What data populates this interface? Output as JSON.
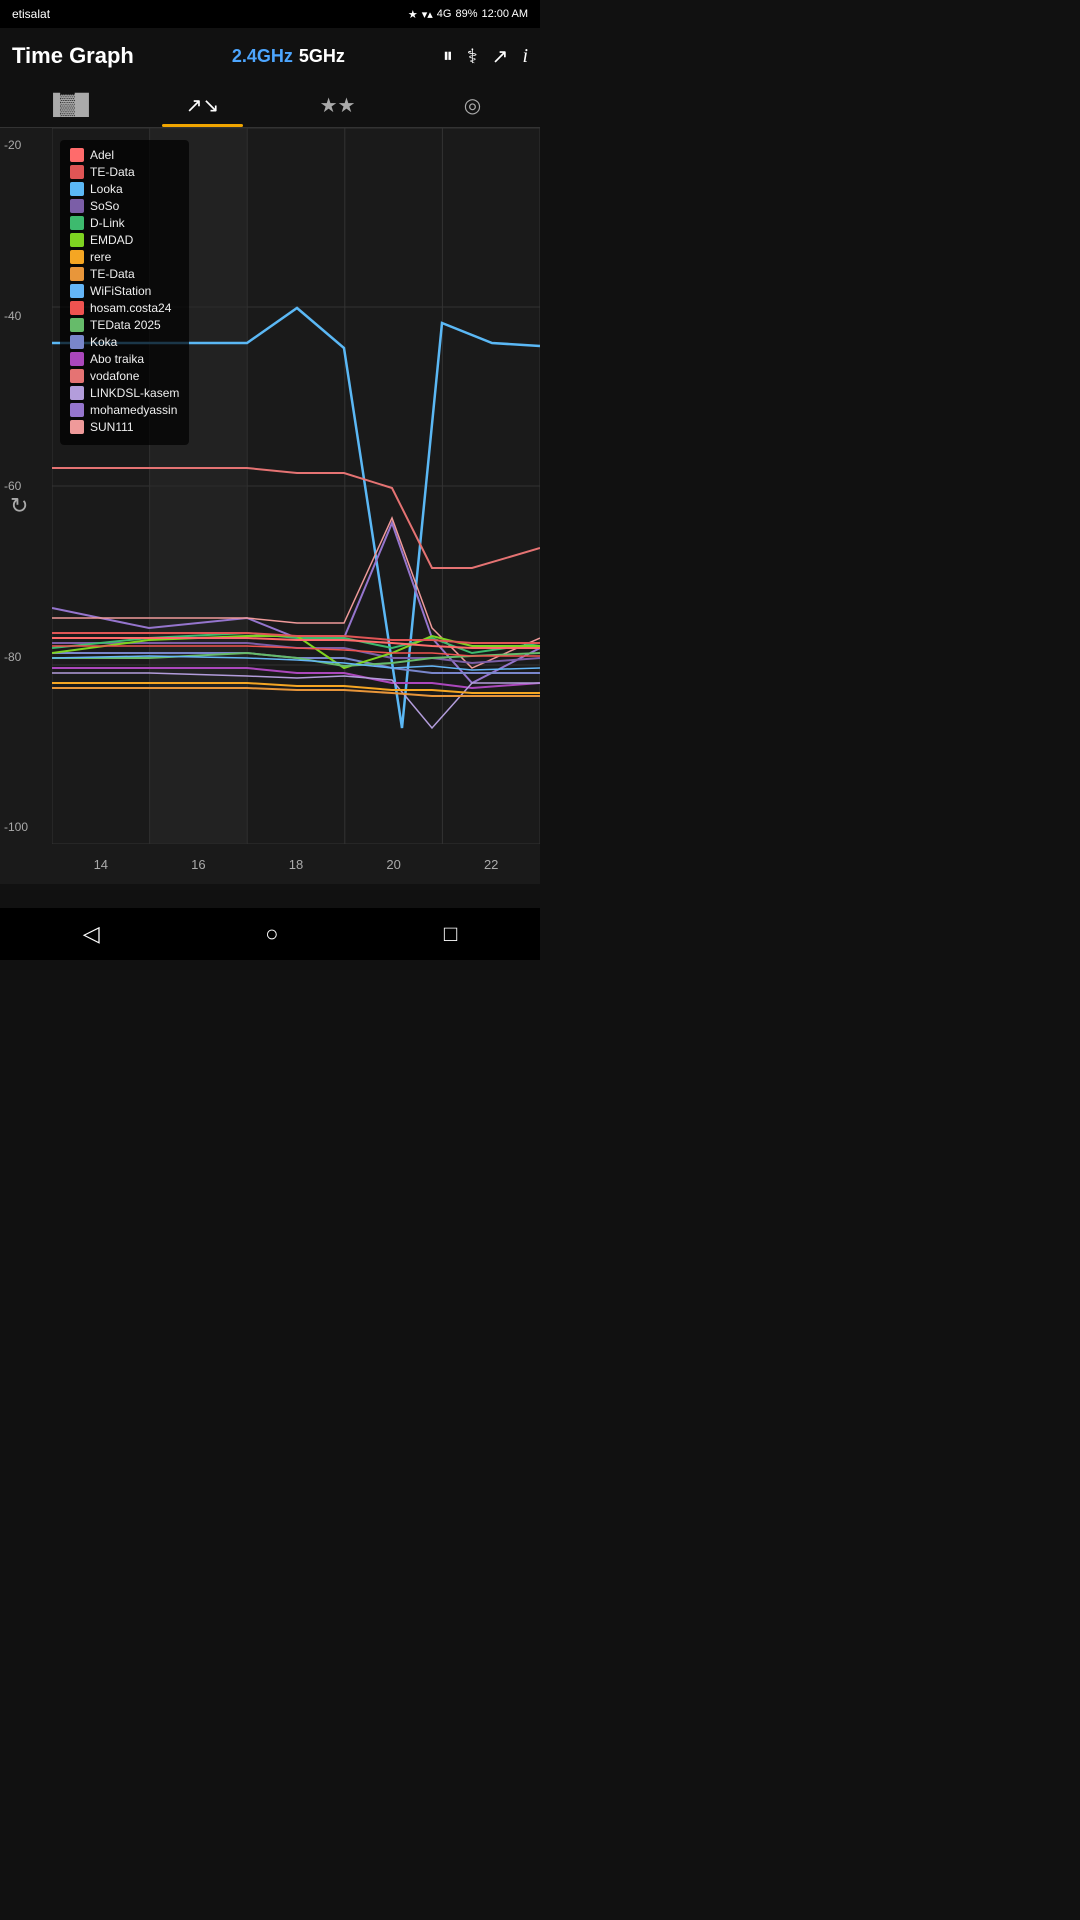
{
  "statusBar": {
    "carrier": "etisalat",
    "icons": "bluetooth wifi 4g signal",
    "battery": "89%",
    "time": "12:00 AM"
  },
  "header": {
    "title": "Time Graph",
    "freq24": "2.4GHz",
    "freq5": "5GHz",
    "icons": [
      "pause",
      "stethoscope",
      "share",
      "info"
    ]
  },
  "tabs": [
    {
      "label": "bar-chart",
      "active": false
    },
    {
      "label": "time-graph",
      "active": true
    },
    {
      "label": "rating",
      "active": false
    },
    {
      "label": "radar",
      "active": false
    }
  ],
  "chart": {
    "yLabels": [
      "-20",
      "-40",
      "-60",
      "-80",
      "-100"
    ],
    "xLabels": [
      "14",
      "16",
      "18",
      "20",
      "22"
    ],
    "legend": [
      {
        "name": "Adel",
        "color": "#ff6b6b"
      },
      {
        "name": "TE-Data",
        "color": "#e05555"
      },
      {
        "name": "Looka",
        "color": "#5bb8f5"
      },
      {
        "name": "SoSo",
        "color": "#7b5ea7"
      },
      {
        "name": "D-Link",
        "color": "#3dba6e"
      },
      {
        "name": "EMDAD",
        "color": "#7ed321"
      },
      {
        "name": "rere",
        "color": "#f5a623"
      },
      {
        "name": "TE-Data",
        "color": "#e8963a"
      },
      {
        "name": "WiFiStation",
        "color": "#64b5f6"
      },
      {
        "name": "hosam.costa24",
        "color": "#ef5350"
      },
      {
        "name": "TEData 2025",
        "color": "#66bb6a"
      },
      {
        "name": "Koka",
        "color": "#7986cb"
      },
      {
        "name": "Abo traika",
        "color": "#ab47bc"
      },
      {
        "name": "vodafone",
        "color": "#e57373"
      },
      {
        "name": "LINKDSL-kasem",
        "color": "#b39ddb"
      },
      {
        "name": "mohamedyassin",
        "color": "#9575cd"
      },
      {
        "name": "SUN111",
        "color": "#ef9a9a"
      }
    ]
  },
  "bottomNav": {
    "back": "◁",
    "home": "○",
    "recent": "□"
  }
}
